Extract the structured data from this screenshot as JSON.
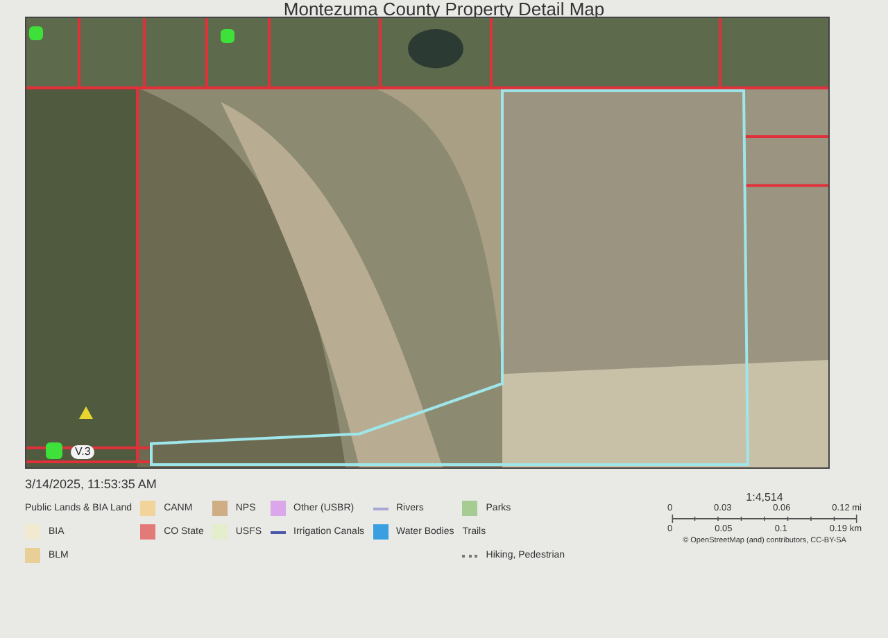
{
  "title": "Montezuma County Property Detail Map",
  "map": {
    "road_label": "V.3"
  },
  "timestamp": "3/14/2025, 11:53:35 AM",
  "legend": {
    "columns": [
      [
        {
          "kind": "heading",
          "label": "Public Lands & BIA Land"
        },
        {
          "kind": "swatch",
          "label": "BIA",
          "color": "#f1ead0"
        },
        {
          "kind": "swatch",
          "label": "BLM",
          "color": "#e8cf98"
        }
      ],
      [
        {
          "kind": "swatch",
          "label": "CANM",
          "color": "#f2d49a"
        },
        {
          "kind": "swatch",
          "label": "CO State",
          "color": "#e27a78"
        }
      ],
      [
        {
          "kind": "swatch",
          "label": "NPS",
          "color": "#cfae86"
        },
        {
          "kind": "swatch",
          "label": "USFS",
          "color": "#e4edcc"
        }
      ],
      [
        {
          "kind": "swatch",
          "label": "Other (USBR)",
          "color": "#dba6ea"
        },
        {
          "kind": "line",
          "label": "Irrigation Canals",
          "color": "#4a5aa8"
        }
      ],
      [
        {
          "kind": "line",
          "label": "Rivers",
          "color": "#a8a8d4"
        },
        {
          "kind": "swatch",
          "label": "Water Bodies",
          "color": "#3a9fe0"
        }
      ],
      [
        {
          "kind": "swatch",
          "label": "Parks",
          "color": "#a6cc94"
        },
        {
          "kind": "heading",
          "label": "Trails"
        },
        {
          "kind": "dashes",
          "label": "Hiking, Pedestrian",
          "color": "#777777"
        }
      ]
    ]
  },
  "scale": {
    "ratio": "1:4,514",
    "top_ticks": [
      "0",
      "0.03",
      "0.06",
      "0.12 mi"
    ],
    "bottom_ticks": [
      "0",
      "0.05",
      "0.1",
      "0.19 km"
    ],
    "attribution": "© OpenStreetMap (and) contributors, CC-BY-SA"
  }
}
